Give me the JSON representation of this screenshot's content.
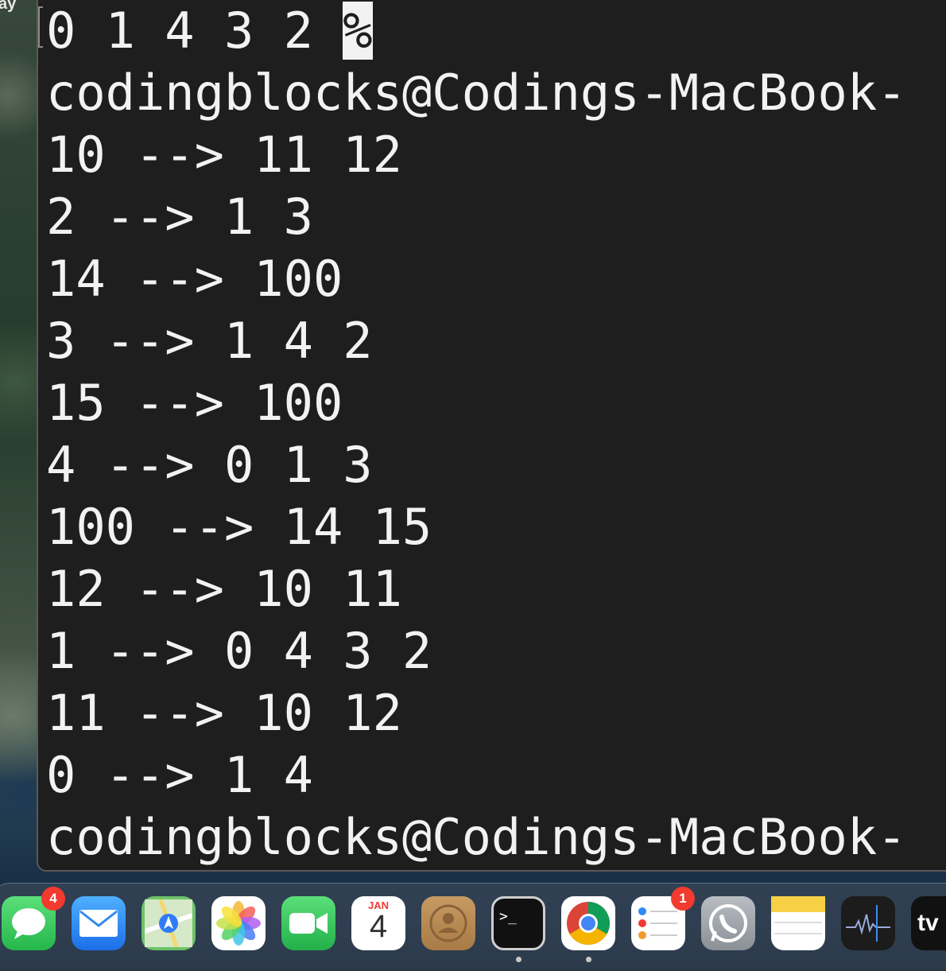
{
  "desktop": {
    "corner_label": "ay"
  },
  "terminal": {
    "lines": [
      {
        "text": "0 1 4 3 2 ",
        "cursor": "%"
      },
      {
        "text": "codingblocks@Codings-MacBook-"
      },
      {
        "text": "10 --> 11 12"
      },
      {
        "text": "2 --> 1 3"
      },
      {
        "text": "14 --> 100"
      },
      {
        "text": "3 --> 1 4 2"
      },
      {
        "text": "15 --> 100"
      },
      {
        "text": "4 --> 0 1 3"
      },
      {
        "text": "100 --> 14 15"
      },
      {
        "text": "12 --> 10 11"
      },
      {
        "text": "1 --> 0 4 3 2"
      },
      {
        "text": "11 --> 10 12"
      },
      {
        "text": "0 --> 1 4"
      },
      {
        "text": "codingblocks@Codings-MacBook-"
      }
    ]
  },
  "dock": {
    "apps": [
      {
        "name": "messages-app-icon",
        "badge": "4",
        "running": false,
        "color": "#34c759"
      },
      {
        "name": "mail-app-icon",
        "badge": null,
        "running": false,
        "color": "#2f8af5"
      },
      {
        "name": "maps-app-icon",
        "badge": null,
        "running": false,
        "color": "#6cc36a"
      },
      {
        "name": "photos-app-icon",
        "badge": null,
        "running": false,
        "color": "#ffffff"
      },
      {
        "name": "facetime-app-icon",
        "badge": null,
        "running": false,
        "color": "#32c15a"
      },
      {
        "name": "calendar-app-icon",
        "badge": null,
        "running": false,
        "color": "#ffffff",
        "month": "JAN",
        "day": "4"
      },
      {
        "name": "contacts-app-icon",
        "badge": null,
        "running": false,
        "color": "#b98b55"
      },
      {
        "name": "terminal-app-icon",
        "badge": null,
        "running": true,
        "color": "#111111"
      },
      {
        "name": "chrome-app-icon",
        "badge": null,
        "running": true,
        "color": "#ffffff"
      },
      {
        "name": "reminders-app-icon",
        "badge": "1",
        "running": false,
        "color": "#ffffff"
      },
      {
        "name": "whatsapp-app-icon",
        "badge": null,
        "running": false,
        "color": "#9aa0a6"
      },
      {
        "name": "notes-app-icon",
        "badge": null,
        "running": false,
        "color": "#ffffff"
      },
      {
        "name": "activity-monitor-app-icon",
        "badge": null,
        "running": false,
        "color": "#1c1c1c"
      },
      {
        "name": "apple-tv-app-icon",
        "badge": null,
        "running": false,
        "color": "#111111",
        "label": "tv"
      }
    ]
  }
}
